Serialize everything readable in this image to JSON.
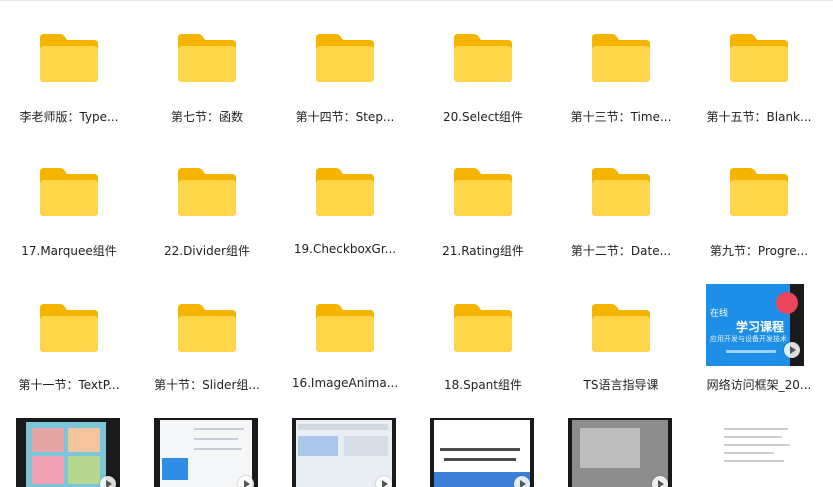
{
  "items": [
    {
      "label": "李老师版：Type...",
      "kind": "folder"
    },
    {
      "label": "第七节：函数",
      "kind": "folder"
    },
    {
      "label": "第十四节：Step...",
      "kind": "folder"
    },
    {
      "label": "20.Select组件",
      "kind": "folder"
    },
    {
      "label": "第十三节：Time...",
      "kind": "folder"
    },
    {
      "label": "第十五节：Blank...",
      "kind": "folder"
    },
    {
      "label": "17.Marquee组件",
      "kind": "folder"
    },
    {
      "label": "22.Divider组件",
      "kind": "folder"
    },
    {
      "label": "19.CheckboxGr...",
      "kind": "folder"
    },
    {
      "label": "21.Rating组件",
      "kind": "folder"
    },
    {
      "label": "第十二节：Date...",
      "kind": "folder"
    },
    {
      "label": "第九节：Progre...",
      "kind": "folder"
    },
    {
      "label": "第十一节：TextP...",
      "kind": "folder"
    },
    {
      "label": "第十节：Slider组...",
      "kind": "folder"
    },
    {
      "label": "16.ImageAnima...",
      "kind": "folder"
    },
    {
      "label": "18.Spant组件",
      "kind": "folder"
    },
    {
      "label": "TS语言指导课",
      "kind": "folder"
    },
    {
      "label": "网络访问框架_20...",
      "kind": "video",
      "thumb_title": "学习课程",
      "thumb_tag": "在线",
      "thumb_sub": "应用开发与设备开发技术"
    },
    {
      "label": "",
      "kind": "video-partial"
    },
    {
      "label": "",
      "kind": "video-partial"
    },
    {
      "label": "",
      "kind": "video-partial"
    },
    {
      "label": "",
      "kind": "video-partial"
    },
    {
      "label": "",
      "kind": "video-partial"
    },
    {
      "label": "",
      "kind": "doc-partial"
    }
  ],
  "colors": {
    "folder_back": "#f5b400",
    "folder_front": "#ffd54a",
    "thumb_blue": "#1e8fe6",
    "thumb_dark": "#1a1a1a"
  },
  "icons": {
    "folder": "folder-icon",
    "video": "video-thumbnail",
    "play": "play-icon"
  }
}
